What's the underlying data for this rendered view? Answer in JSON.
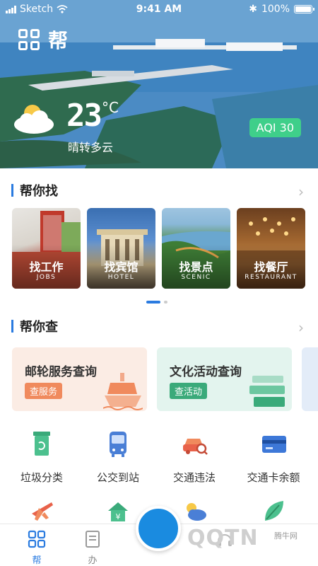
{
  "status_bar": {
    "carrier": "Sketch",
    "time": "9:41 AM",
    "battery": "100%"
  },
  "header": {
    "app_name": "帮"
  },
  "weather": {
    "temperature": "23",
    "unit": "°C",
    "description": "晴转多云",
    "aqi": "AQI 30"
  },
  "find_section": {
    "title": "帮你找",
    "cards": [
      {
        "title": "找工作",
        "subtitle": "JOBS"
      },
      {
        "title": "找宾馆",
        "subtitle": "HOTEL"
      },
      {
        "title": "找景点",
        "subtitle": "SCENIC"
      },
      {
        "title": "找餐厅",
        "subtitle": "RESTAURANT"
      }
    ]
  },
  "query_section": {
    "title": "帮你查",
    "cards": [
      {
        "title": "邮轮服务查询",
        "button": "查服务",
        "color": "#f08a5d"
      },
      {
        "title": "文化活动查询",
        "button": "查活动",
        "color": "#3aaa7a"
      }
    ]
  },
  "services": [
    {
      "label": "垃圾分类",
      "icon": "trash-bin-icon"
    },
    {
      "label": "公交到站",
      "icon": "bus-icon"
    },
    {
      "label": "交通违法",
      "icon": "car-search-icon"
    },
    {
      "label": "交通卡余额",
      "icon": "transit-card-icon"
    },
    {
      "label": "",
      "icon": "airplane-icon"
    },
    {
      "label": "",
      "icon": "house-yuan-icon"
    },
    {
      "label": "",
      "icon": "sun-cloud-icon"
    },
    {
      "label": "",
      "icon": "leaf-icon"
    }
  ],
  "tabbar": {
    "tabs": [
      {
        "label": "帮"
      },
      {
        "label": "办"
      }
    ],
    "watermark": "QQTN",
    "watermark_small": "腾牛网"
  },
  "colors": {
    "accent": "#2a7be0",
    "aqi": "#3fcf8a"
  }
}
